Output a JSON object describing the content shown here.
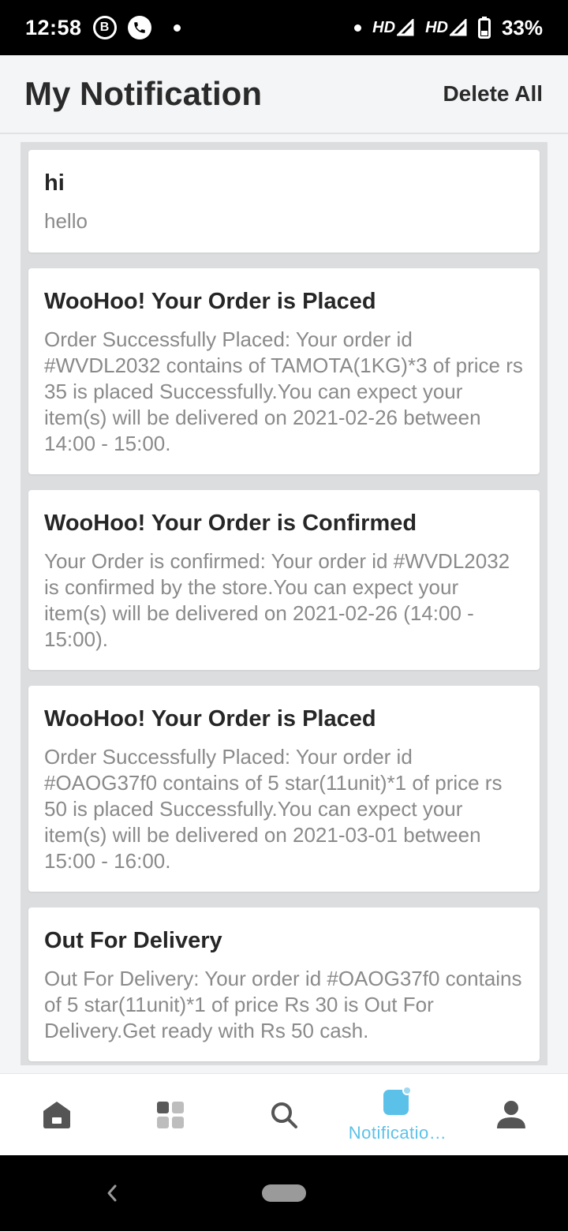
{
  "status_bar": {
    "time": "12:58",
    "b_badge": "B",
    "hd1": "HD",
    "hd2": "HD",
    "battery": "33%"
  },
  "header": {
    "title": "My Notification",
    "delete_all": "Delete All"
  },
  "notifications": [
    {
      "title": "hi",
      "body": "hello"
    },
    {
      "title": "WooHoo! Your Order is Placed",
      "body": "Order Successfully Placed: Your order id #WVDL2032 contains of TAMOTA(1KG)*3 of price rs 35 is placed Successfully.You can expect your item(s) will be delivered on 2021-02-26 between 14:00 - 15:00."
    },
    {
      "title": "WooHoo! Your Order is Confirmed",
      "body": "Your Order is confirmed: Your order id #WVDL2032 is confirmed by the store.You can expect your item(s) will be delivered on 2021-02-26 (14:00 - 15:00)."
    },
    {
      "title": "WooHoo! Your Order is Placed",
      "body": "Order Successfully Placed: Your order id #OAOG37f0 contains of 5 star(11unit)*1 of price rs 50 is placed Successfully.You can expect your item(s) will be delivered on 2021-03-01 between 15:00 - 16:00."
    },
    {
      "title": "Out For Delivery",
      "body": "Out For Delivery: Your order id #OAOG37f0 contains of 5 star(11unit)*1 of price Rs 30 is Out For Delivery.Get ready with Rs 50 cash."
    }
  ],
  "bottom_nav": {
    "items": [
      {
        "icon": "home-icon",
        "label": ""
      },
      {
        "icon": "grid-icon",
        "label": ""
      },
      {
        "icon": "search-icon",
        "label": ""
      },
      {
        "icon": "notification-icon",
        "label": "Notificatio…"
      },
      {
        "icon": "profile-icon",
        "label": ""
      }
    ],
    "active_color": "#5bc1e8",
    "inactive_color": "#555555"
  }
}
